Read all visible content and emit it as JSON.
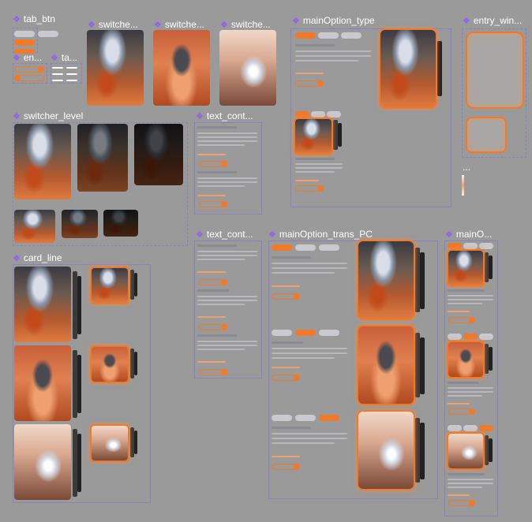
{
  "components": {
    "tab_btn": "tab_btn",
    "en": "en...",
    "ta": "ta...",
    "switcher_1": "switche...",
    "switcher_2": "switche...",
    "switcher_3": "switche...",
    "mainOption_type": "mainOption_type",
    "entry_win": "entry_win...",
    "switcher_level": "switcher_level",
    "text_cont_1": "text_cont...",
    "text_cont_2": "text_cont...",
    "mainOption_trans_PC": "mainOption_trans_PC",
    "mainO": "mainO...",
    "card_line": "card_line",
    "ellipsis": "..."
  },
  "colors": {
    "accent": "#f07a2a",
    "frame": "#8b80b8",
    "canvas": "#9a9a9a",
    "diamond": "#8b5cf6"
  },
  "icons": {
    "component": "component-diamond-icon",
    "arrow": "arrow-right-icon"
  }
}
